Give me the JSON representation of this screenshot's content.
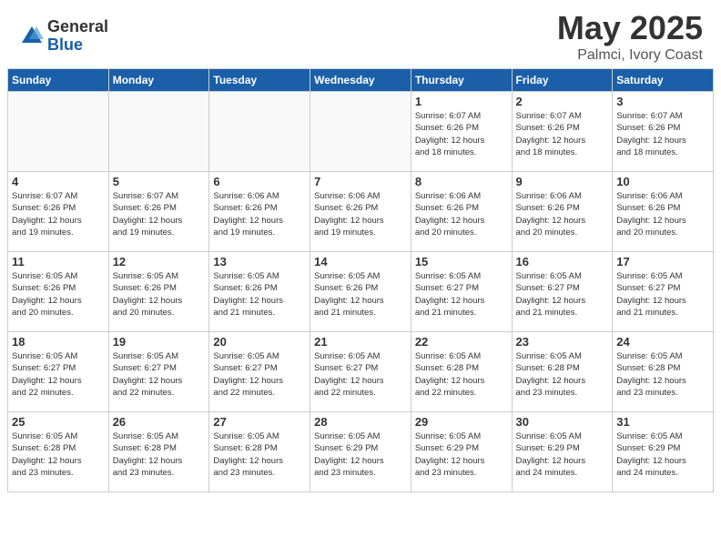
{
  "header": {
    "logo_general": "General",
    "logo_blue": "Blue",
    "month": "May 2025",
    "location": "Palmci, Ivory Coast"
  },
  "weekdays": [
    "Sunday",
    "Monday",
    "Tuesday",
    "Wednesday",
    "Thursday",
    "Friday",
    "Saturday"
  ],
  "weeks": [
    [
      {
        "day": "",
        "info": ""
      },
      {
        "day": "",
        "info": ""
      },
      {
        "day": "",
        "info": ""
      },
      {
        "day": "",
        "info": ""
      },
      {
        "day": "1",
        "info": "Sunrise: 6:07 AM\nSunset: 6:26 PM\nDaylight: 12 hours\nand 18 minutes."
      },
      {
        "day": "2",
        "info": "Sunrise: 6:07 AM\nSunset: 6:26 PM\nDaylight: 12 hours\nand 18 minutes."
      },
      {
        "day": "3",
        "info": "Sunrise: 6:07 AM\nSunset: 6:26 PM\nDaylight: 12 hours\nand 18 minutes."
      }
    ],
    [
      {
        "day": "4",
        "info": "Sunrise: 6:07 AM\nSunset: 6:26 PM\nDaylight: 12 hours\nand 19 minutes."
      },
      {
        "day": "5",
        "info": "Sunrise: 6:07 AM\nSunset: 6:26 PM\nDaylight: 12 hours\nand 19 minutes."
      },
      {
        "day": "6",
        "info": "Sunrise: 6:06 AM\nSunset: 6:26 PM\nDaylight: 12 hours\nand 19 minutes."
      },
      {
        "day": "7",
        "info": "Sunrise: 6:06 AM\nSunset: 6:26 PM\nDaylight: 12 hours\nand 19 minutes."
      },
      {
        "day": "8",
        "info": "Sunrise: 6:06 AM\nSunset: 6:26 PM\nDaylight: 12 hours\nand 20 minutes."
      },
      {
        "day": "9",
        "info": "Sunrise: 6:06 AM\nSunset: 6:26 PM\nDaylight: 12 hours\nand 20 minutes."
      },
      {
        "day": "10",
        "info": "Sunrise: 6:06 AM\nSunset: 6:26 PM\nDaylight: 12 hours\nand 20 minutes."
      }
    ],
    [
      {
        "day": "11",
        "info": "Sunrise: 6:05 AM\nSunset: 6:26 PM\nDaylight: 12 hours\nand 20 minutes."
      },
      {
        "day": "12",
        "info": "Sunrise: 6:05 AM\nSunset: 6:26 PM\nDaylight: 12 hours\nand 20 minutes."
      },
      {
        "day": "13",
        "info": "Sunrise: 6:05 AM\nSunset: 6:26 PM\nDaylight: 12 hours\nand 21 minutes."
      },
      {
        "day": "14",
        "info": "Sunrise: 6:05 AM\nSunset: 6:26 PM\nDaylight: 12 hours\nand 21 minutes."
      },
      {
        "day": "15",
        "info": "Sunrise: 6:05 AM\nSunset: 6:27 PM\nDaylight: 12 hours\nand 21 minutes."
      },
      {
        "day": "16",
        "info": "Sunrise: 6:05 AM\nSunset: 6:27 PM\nDaylight: 12 hours\nand 21 minutes."
      },
      {
        "day": "17",
        "info": "Sunrise: 6:05 AM\nSunset: 6:27 PM\nDaylight: 12 hours\nand 21 minutes."
      }
    ],
    [
      {
        "day": "18",
        "info": "Sunrise: 6:05 AM\nSunset: 6:27 PM\nDaylight: 12 hours\nand 22 minutes."
      },
      {
        "day": "19",
        "info": "Sunrise: 6:05 AM\nSunset: 6:27 PM\nDaylight: 12 hours\nand 22 minutes."
      },
      {
        "day": "20",
        "info": "Sunrise: 6:05 AM\nSunset: 6:27 PM\nDaylight: 12 hours\nand 22 minutes."
      },
      {
        "day": "21",
        "info": "Sunrise: 6:05 AM\nSunset: 6:27 PM\nDaylight: 12 hours\nand 22 minutes."
      },
      {
        "day": "22",
        "info": "Sunrise: 6:05 AM\nSunset: 6:28 PM\nDaylight: 12 hours\nand 22 minutes."
      },
      {
        "day": "23",
        "info": "Sunrise: 6:05 AM\nSunset: 6:28 PM\nDaylight: 12 hours\nand 23 minutes."
      },
      {
        "day": "24",
        "info": "Sunrise: 6:05 AM\nSunset: 6:28 PM\nDaylight: 12 hours\nand 23 minutes."
      }
    ],
    [
      {
        "day": "25",
        "info": "Sunrise: 6:05 AM\nSunset: 6:28 PM\nDaylight: 12 hours\nand 23 minutes."
      },
      {
        "day": "26",
        "info": "Sunrise: 6:05 AM\nSunset: 6:28 PM\nDaylight: 12 hours\nand 23 minutes."
      },
      {
        "day": "27",
        "info": "Sunrise: 6:05 AM\nSunset: 6:28 PM\nDaylight: 12 hours\nand 23 minutes."
      },
      {
        "day": "28",
        "info": "Sunrise: 6:05 AM\nSunset: 6:29 PM\nDaylight: 12 hours\nand 23 minutes."
      },
      {
        "day": "29",
        "info": "Sunrise: 6:05 AM\nSunset: 6:29 PM\nDaylight: 12 hours\nand 23 minutes."
      },
      {
        "day": "30",
        "info": "Sunrise: 6:05 AM\nSunset: 6:29 PM\nDaylight: 12 hours\nand 24 minutes."
      },
      {
        "day": "31",
        "info": "Sunrise: 6:05 AM\nSunset: 6:29 PM\nDaylight: 12 hours\nand 24 minutes."
      }
    ]
  ]
}
